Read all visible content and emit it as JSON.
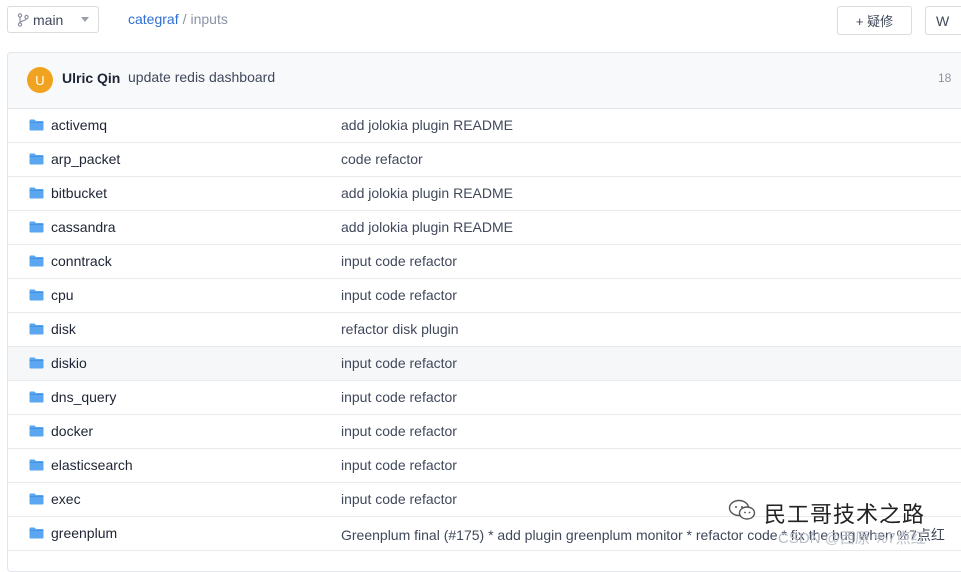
{
  "branch": {
    "label": "main"
  },
  "breadcrumb": {
    "repo": "categraf",
    "separator": "/",
    "path": "inputs"
  },
  "toolbar": {
    "add_label": "+ 疑修",
    "clone_label": "W"
  },
  "latest_commit": {
    "avatar_letter": "U",
    "author": "Ulric Qin",
    "message": "update redis dashboard",
    "time": "18",
    "avatar_color": "#f0a31f"
  },
  "files": [
    {
      "name": "activemq",
      "message": "add jolokia plugin README"
    },
    {
      "name": "arp_packet",
      "message": "code refactor"
    },
    {
      "name": "bitbucket",
      "message": "add jolokia plugin README"
    },
    {
      "name": "cassandra",
      "message": "add jolokia plugin README"
    },
    {
      "name": "conntrack",
      "message": "input code refactor"
    },
    {
      "name": "cpu",
      "message": "input code refactor"
    },
    {
      "name": "disk",
      "message": "refactor disk plugin"
    },
    {
      "name": "diskio",
      "message": "input code refactor"
    },
    {
      "name": "dns_query",
      "message": "input code refactor"
    },
    {
      "name": "docker",
      "message": "input code refactor"
    },
    {
      "name": "elasticsearch",
      "message": "input code refactor"
    },
    {
      "name": "exec",
      "message": "input code refactor"
    },
    {
      "name": "greenplum",
      "message": "Greenplum final (#175) * add plugin greenplum monitor * refactor code * fix the bug when %7点红"
    }
  ],
  "watermark": {
    "title": "民工哥技术之路",
    "subtitle": "CSDN @西原 %7点红"
  },
  "colors": {
    "folder": "#5aa6f0",
    "link": "#2d6fd6",
    "hover_row": "#f6f7f9"
  }
}
